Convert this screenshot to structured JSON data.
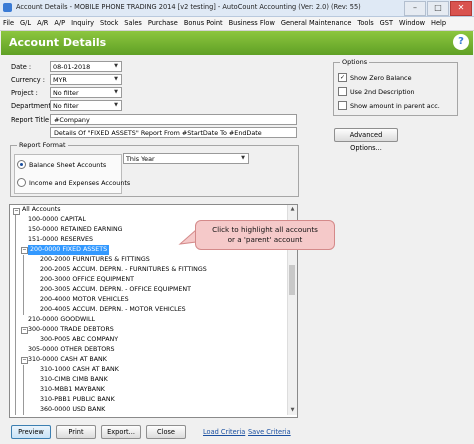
{
  "window": {
    "title": "Account Details - MOBILE PHONE TRADING 2014 [v2 testing] - AutoCount Accounting (Ver: 2.0) (Rev: 55)"
  },
  "menu": [
    "File",
    "G/L",
    "A/R",
    "A/P",
    "Inquiry",
    "Stock",
    "Sales",
    "Purchase",
    "Bonus Point",
    "Business Flow",
    "General Maintenance",
    "Tools",
    "GST",
    "Window",
    "Help"
  ],
  "header": {
    "title": "Account Details",
    "help": "?"
  },
  "form": {
    "date_label": "Date :",
    "date_value": "08-01-2018",
    "currency_label": "Currency :",
    "currency_value": "MYR",
    "project_label": "Project :",
    "project_value": "No filter",
    "department_label": "Department :",
    "department_value": "No filter",
    "report_title_label": "Report Title :",
    "report_title_1": "#Company",
    "report_title_2": "Details Of \"FIXED ASSETS\" Report From #StartDate To #EndDate"
  },
  "report_format": {
    "title": "Report Format",
    "option_balance": "Balance Sheet Accounts",
    "option_income": "Income and Expenses Accounts",
    "period_value": "This Year"
  },
  "options": {
    "title": "Options",
    "show_zero": "Show Zero Balance",
    "use_2nd": "Use 2nd Description",
    "show_parent": "Show amount in parent acc.",
    "show_zero_checked": true,
    "advanced": "Advanced Options..."
  },
  "tree": {
    "root": "All Accounts",
    "items": [
      "100-0000  CAPITAL",
      "150-0000  RETAINED EARNING",
      "151-0000  RESERVES",
      "200-0000  FIXED ASSETS",
      "200-2000  FURNITURES & FITTINGS",
      "200-2005  ACCUM. DEPRN. - FURNITURES & FITTINGS",
      "200-3000  OFFICE EQUIPMENT",
      "200-3005  ACCUM. DEPRN. - OFFICE EQUIPMENT",
      "200-4000  MOTOR VEHICLES",
      "200-4005  ACCUM. DEPRN. - MOTOR VEHICLES",
      "210-0000  GOODWILL",
      "300-0000  TRADE DEBTORS",
      "300-P005  ABC COMPANY",
      "305-0000  OTHER DEBTORS",
      "310-0000  CASH AT BANK",
      "310-1000  CASH AT BANK",
      "310-CIMB  CIMB BANK",
      "310-MBB1  MAYBANK",
      "310-PBB1  PUBLIC BANK",
      "360-0000  USD BANK"
    ]
  },
  "callout": {
    "line1": "Click to highlight all accounts",
    "line2": "or a 'parent' account"
  },
  "buttons": {
    "preview": "Preview",
    "print": "Print",
    "export": "Export...",
    "close": "Close"
  },
  "links": {
    "load": "Load Criteria",
    "save": "Save Criteria"
  }
}
